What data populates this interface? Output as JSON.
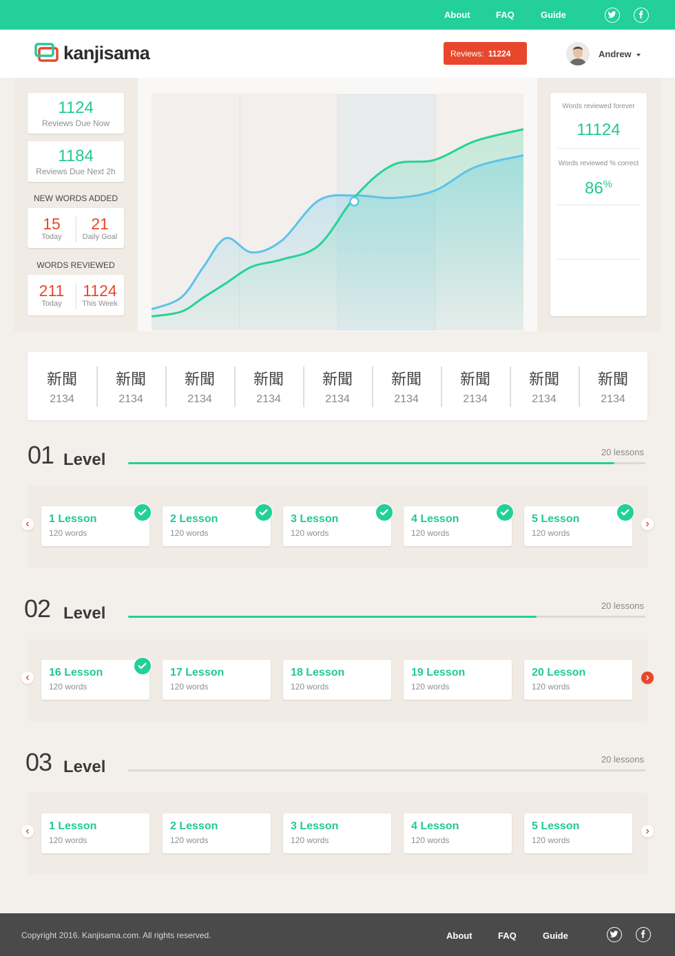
{
  "topnav": {
    "about": "About",
    "faq": "FAQ",
    "guide": "Guide"
  },
  "header": {
    "logo": "kanjisama",
    "reviews_label": "Reviews:",
    "reviews_count": "11224",
    "user_name": "Andrew"
  },
  "stats": {
    "reviews_due_now": {
      "value": "1124",
      "label": "Reviews Due Now"
    },
    "reviews_due_next": {
      "value": "1184",
      "label": "Reviews Due Next 2h"
    },
    "new_words": {
      "title": "NEW WORDS ADDED",
      "today_value": "15",
      "today_label": "Today",
      "goal_value": "21",
      "goal_label": "Daily Goal"
    },
    "words_reviewed": {
      "title": "WORDS REVIEWED",
      "today_value": "211",
      "today_label": "Today",
      "week_value": "1124",
      "week_label": "This Week"
    }
  },
  "right_panel": {
    "forever_label": "Words reviewed forever",
    "forever_value": "11124",
    "correct_label": "Words reviewed % correct",
    "correct_value": "86",
    "correct_unit": "%"
  },
  "chart_data": {
    "type": "area",
    "title": "",
    "xlabel": "",
    "ylabel": "",
    "grid": true,
    "x": [
      0,
      0.08,
      0.14,
      0.2,
      0.27,
      0.35,
      0.45,
      0.55,
      0.65,
      0.76,
      0.87,
      1.0
    ],
    "series": [
      {
        "values": [
          0.09,
          0.14,
          0.27,
          0.39,
          0.33,
          0.38,
          0.55,
          0.57,
          0.56,
          0.59,
          0.69,
          0.74
        ]
      },
      {
        "values": [
          0.06,
          0.08,
          0.14,
          0.2,
          0.27,
          0.3,
          0.36,
          0.57,
          0.7,
          0.72,
          0.8,
          0.85
        ]
      }
    ],
    "colors": {
      "line_a": "#5bc3ea",
      "line_b": "#24d396"
    }
  },
  "kanji": [
    {
      "kanji": "新聞",
      "count": "2134"
    },
    {
      "kanji": "新聞",
      "count": "2134"
    },
    {
      "kanji": "新聞",
      "count": "2134"
    },
    {
      "kanji": "新聞",
      "count": "2134"
    },
    {
      "kanji": "新聞",
      "count": "2134"
    },
    {
      "kanji": "新聞",
      "count": "2134"
    },
    {
      "kanji": "新聞",
      "count": "2134"
    },
    {
      "kanji": "新聞",
      "count": "2134"
    },
    {
      "kanji": "新聞",
      "count": "2134"
    }
  ],
  "levels": [
    {
      "number": "01",
      "word": "Level",
      "count_label": "20 lessons",
      "progress": 0.94,
      "lessons": [
        {
          "title": "1 Lesson",
          "words": "120 words",
          "done": true
        },
        {
          "title": "2 Lesson",
          "words": "120 words",
          "done": true
        },
        {
          "title": "3 Lesson",
          "words": "120 words",
          "done": true
        },
        {
          "title": "4 Lesson",
          "words": "120 words",
          "done": true
        },
        {
          "title": "5 Lesson",
          "words": "120 words",
          "done": true
        }
      ]
    },
    {
      "number": "02",
      "word": "Level",
      "count_label": "20 lessons",
      "progress": 0.79,
      "lessons": [
        {
          "title": "16 Lesson",
          "words": "120 words",
          "done": true
        },
        {
          "title": "17 Lesson",
          "words": "120 words",
          "done": false
        },
        {
          "title": "18 Lesson",
          "words": "120 words",
          "done": false
        },
        {
          "title": "19 Lesson",
          "words": "120 words",
          "done": false
        },
        {
          "title": "20 Lesson",
          "words": "120 words",
          "done": false
        }
      ]
    },
    {
      "number": "03",
      "word": "Level",
      "count_label": "20 lessons",
      "progress": 0,
      "lessons": [
        {
          "title": "1 Lesson",
          "words": "120 words",
          "done": false
        },
        {
          "title": "2 Lesson",
          "words": "120 words",
          "done": false
        },
        {
          "title": "3 Lesson",
          "words": "120 words",
          "done": false
        },
        {
          "title": "4 Lesson",
          "words": "120 words",
          "done": false
        },
        {
          "title": "5 Lesson",
          "words": "120 words",
          "done": false
        }
      ]
    }
  ],
  "footer": {
    "copyright": "Copyright 2016. Kanjisama.com. All rights reserved.",
    "about": "About",
    "faq": "FAQ",
    "guide": "Guide"
  },
  "colors": {
    "accent": "#22d098",
    "alert": "#e8472c",
    "footer": "#4a4a4a"
  }
}
